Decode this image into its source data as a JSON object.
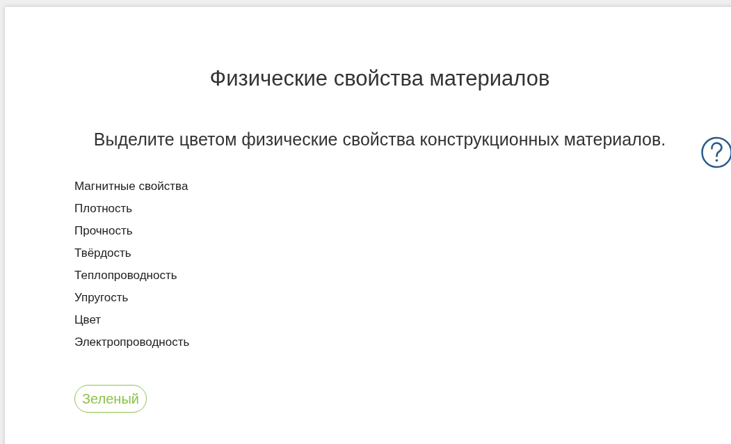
{
  "title": "Физические свойства материалов",
  "instruction": "Выделите цветом физические свойства конструкционных материалов.",
  "items": [
    {
      "label": "Магнитные свойства"
    },
    {
      "label": "Плотность"
    },
    {
      "label": "Прочность"
    },
    {
      "label": "Твёрдость"
    },
    {
      "label": "Теплопроводность"
    },
    {
      "label": "Упругость"
    },
    {
      "label": "Цвет"
    },
    {
      "label": "Электропроводность"
    }
  ],
  "colors": [
    {
      "label": "Зеленый",
      "color": "#8bc34a"
    }
  ]
}
